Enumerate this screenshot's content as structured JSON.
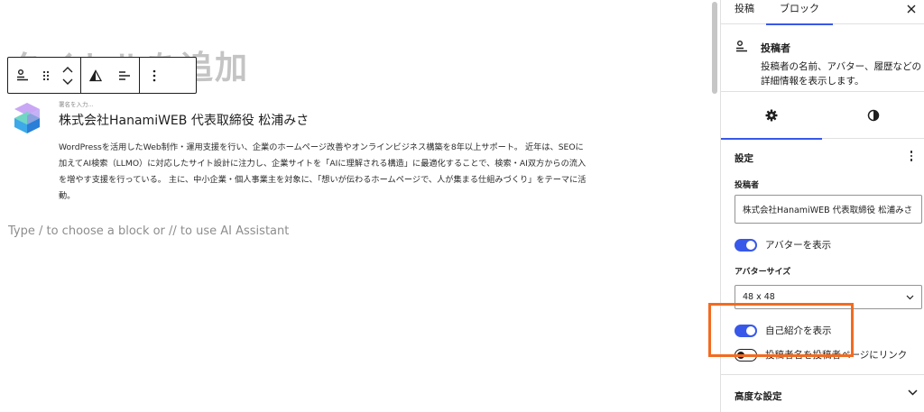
{
  "editor": {
    "title_placeholder": "タイトルを追加",
    "byline_placeholder": "署名を入力...",
    "author_name": "株式会社HanamiWEB 代表取締役 松浦みさ",
    "author_bio": "WordPressを活用したWeb制作・運用支援を行い、企業のホームページ改善やオンラインビジネス構築を8年以上サポート。 近年は、SEOに加えてAI検索（LLMO）に対応したサイト設計に注力し、企業サイトを「AIに理解される構造」に最適化することで、検索・AI双方からの流入を増やす支援を行っている。 主に、中小企業・個人事業主を対象に、「想いが伝わるホームページで、人が集まる仕組みづくり」をテーマに活動。",
    "paragraph_placeholder": "Type / to choose a block or // to use AI Assistant"
  },
  "sidebar": {
    "tabs": [
      {
        "label": "投稿"
      },
      {
        "label": "ブロック"
      }
    ],
    "block_card": {
      "title": "投稿者",
      "description": "投稿者の名前、アバター、履歴などの詳細情報を表示します。"
    },
    "settings": {
      "title": "設定",
      "author_label": "投稿者",
      "author_value": "株式会社HanamiWEB 代表取締役 松浦みさ",
      "show_avatar_label": "アバターを表示",
      "avatar_size_label": "アバターサイズ",
      "avatar_size_value": "48 x 48",
      "show_bio_label": "自己紹介を表示",
      "link_author_label": "投稿者名を投稿者ページにリンク"
    },
    "advanced_label": "高度な設定"
  },
  "toggles": {
    "show_avatar": true,
    "show_bio": true,
    "link_author": false
  },
  "colors": {
    "accent": "#3858e9",
    "highlight": "#f26b21"
  }
}
